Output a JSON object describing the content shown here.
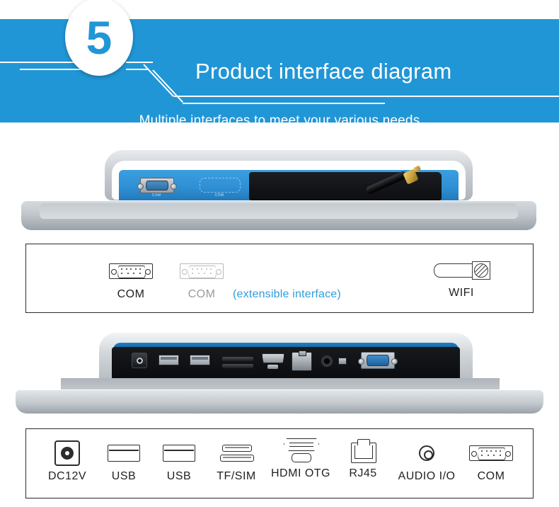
{
  "header": {
    "badge_number": "5",
    "title": "Product interface diagram",
    "subtitle": "Multiple interfaces to meet your various needs",
    "watermark": "",
    "background_color": "#2196d6",
    "text_color": "#ffffff"
  },
  "device_top": {
    "name": "rear-panel-view",
    "port_labels": [
      "COM",
      "COM"
    ]
  },
  "device_bottom": {
    "name": "io-panel-view"
  },
  "legend_top": {
    "note": "(extensible interface)",
    "note_color": "#2f9ddb",
    "items": [
      {
        "label": "COM",
        "icon": "dsub-com-icon",
        "state": "active"
      },
      {
        "label": "COM",
        "icon": "dsub-com-icon",
        "state": "extensible"
      },
      {
        "label": "WIFI",
        "icon": "wifi-antenna-icon",
        "state": "active"
      }
    ]
  },
  "legend_bottom": {
    "items": [
      {
        "label": "DC12V",
        "icon": "dc-power-icon"
      },
      {
        "label": "USB",
        "icon": "usb-icon"
      },
      {
        "label": "USB",
        "icon": "usb-icon"
      },
      {
        "label": "TF/SIM",
        "icon": "tf-sim-slot-icon"
      },
      {
        "label": "HDMI OTG",
        "icon": "hdmi-otg-icon"
      },
      {
        "label": "RJ45",
        "icon": "rj45-icon"
      },
      {
        "label": "AUDIO I/O",
        "icon": "audio-jack-icon"
      },
      {
        "label": "COM",
        "icon": "dsub-com-icon"
      }
    ]
  }
}
